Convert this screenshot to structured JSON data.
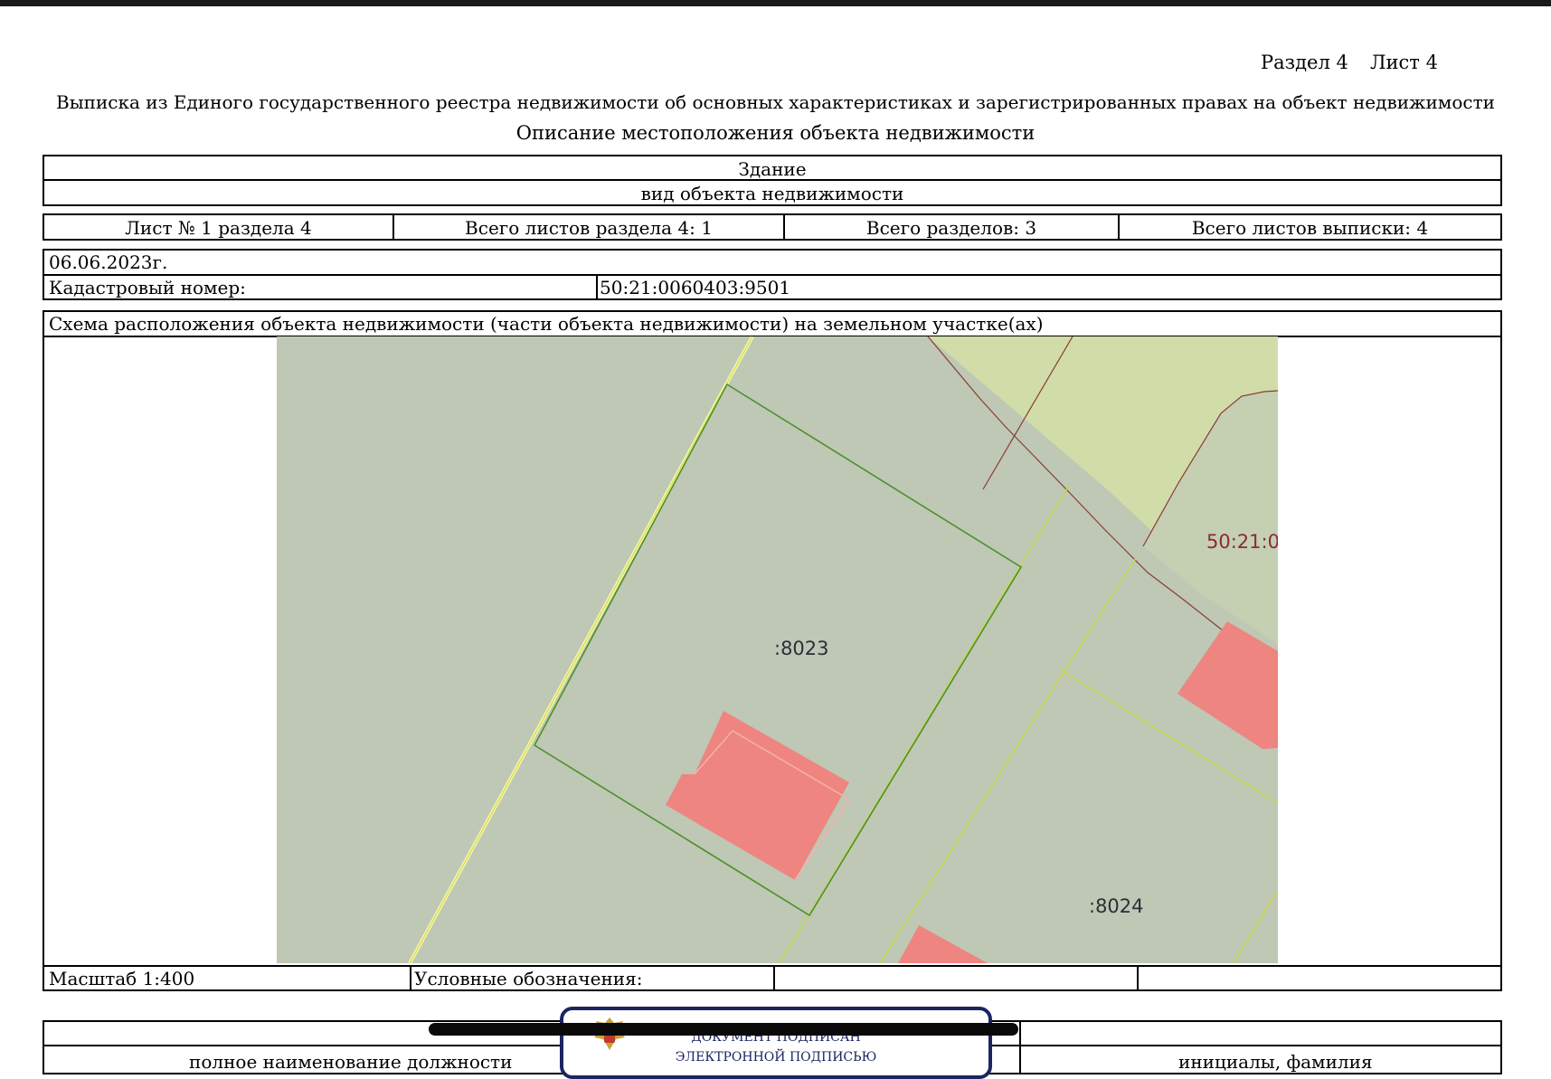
{
  "header": {
    "section": "Раздел 4",
    "sheet": "Лист 4",
    "title": "Выписка из Единого государственного реестра недвижимости об основных характеристиках и зарегистрированных правах на объект недвижимости",
    "subtitle": "Описание местоположения объекта недвижимости"
  },
  "object": {
    "type": "Здание",
    "type_caption": "вид объекта недвижимости"
  },
  "sheets_row": {
    "sheet_no": "Лист № 1 раздела 4",
    "total_sheets_section": "Всего листов раздела 4: 1",
    "total_sections": "Всего разделов: 3",
    "total_sheets": "Всего листов выписки: 4"
  },
  "info": {
    "date": "06.06.2023г.",
    "cadastral_label": "Кадастровый номер:",
    "cadastral_number": "50:21:0060403:9501"
  },
  "scheme": {
    "title": "Схема расположения объекта недвижимости (части объекта недвижимости) на земельном участке(ах)",
    "labels": {
      "parcel_a": ":8023",
      "parcel_b": ":8024",
      "parcel_c": "50:21:0"
    },
    "colors": {
      "background": "#bec8b5",
      "light_green": "#d1dda8",
      "building": "#ee8580",
      "boundary_green": "#4e8f2a",
      "boundary_yellow": "#c9d84a",
      "boundary_red": "#8a3a3a",
      "label_red": "#8a2a3a"
    }
  },
  "footer_row": {
    "scale": "Масштаб 1:400",
    "legend": "Условные обозначения:"
  },
  "signature": {
    "stamp_line1": "ДОКУМЕНТ ПОДПИСАН",
    "stamp_line2": "ЭЛЕКТРОННОЙ ПОДПИСЬЮ",
    "position_caption": "полное наименование должности",
    "name_caption": "инициалы, фамилия"
  }
}
